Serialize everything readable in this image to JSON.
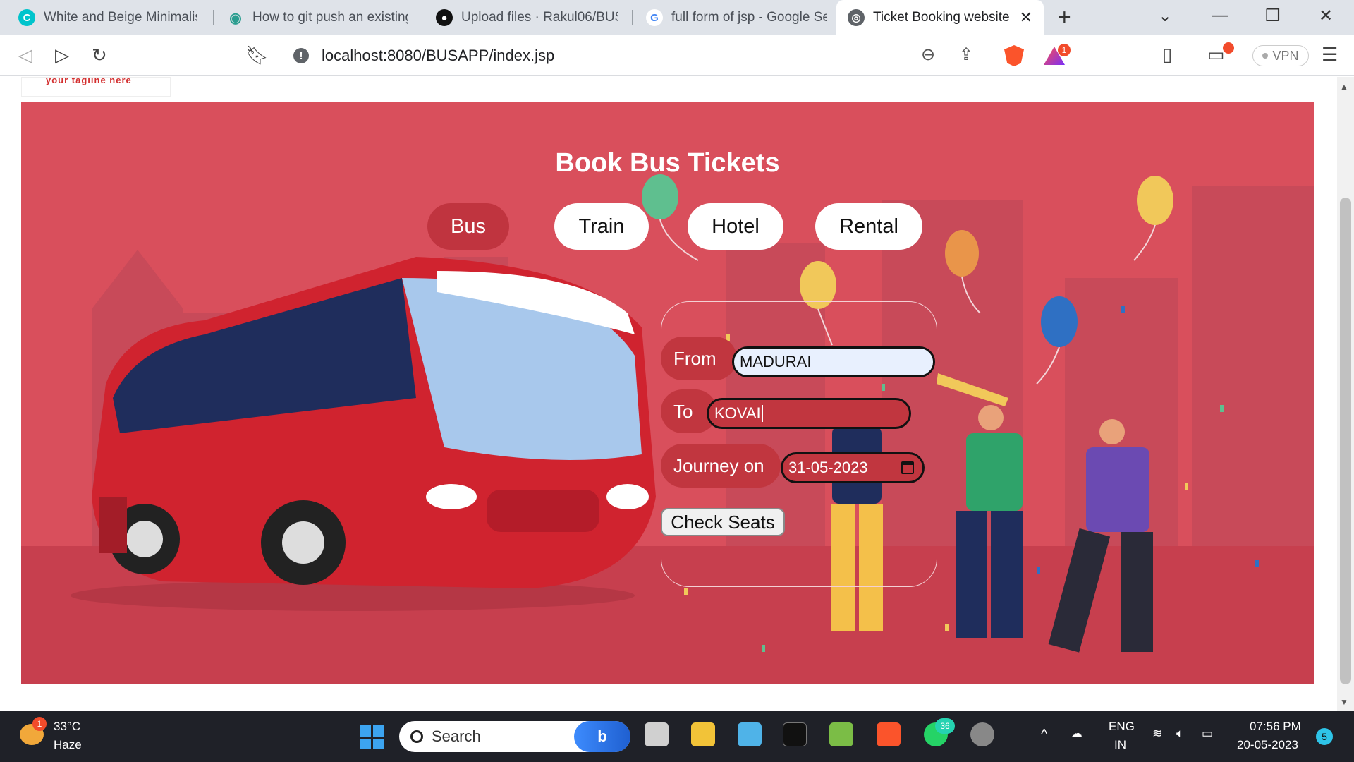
{
  "browser": {
    "tabs": [
      {
        "title": "White and Beige Minimalis",
        "icon": "canva-icon",
        "color": "#00c4cc"
      },
      {
        "title": "How to git push an existing",
        "icon": "eye-icon",
        "color": "#2a9d8f"
      },
      {
        "title": "Upload files · Rakul06/BUS",
        "icon": "github-icon",
        "color": "#111111"
      },
      {
        "title": "full form of jsp - Google Se",
        "icon": "google-icon",
        "color": "#4285f4"
      },
      {
        "title": "Ticket Booking website",
        "icon": "globe-icon",
        "color": "#5f6368"
      }
    ],
    "url": "localhost:8080/BUSAPP/index.jsp",
    "rewards_badge": "1",
    "vpn_label": "VPN"
  },
  "page": {
    "logo_tagline": "your tagline here",
    "title": "Book Bus Tickets",
    "nav": [
      {
        "label": "Bus",
        "active": true
      },
      {
        "label": "Train",
        "active": false
      },
      {
        "label": "Hotel",
        "active": false
      },
      {
        "label": "Rental",
        "active": false
      }
    ],
    "form": {
      "from_label": "From",
      "from_value": "MADURAI",
      "to_label": "To",
      "to_value": "KOVAI",
      "date_label": "Journey on",
      "date_value": "31-05-2023",
      "submit_label": "Check Seats"
    }
  },
  "taskbar": {
    "weather_temp": "33°C",
    "weather_desc": "Haze",
    "weather_badge": "1",
    "search_label": "Search",
    "whatsapp_badge": "36",
    "lang_top": "ENG",
    "lang_bottom": "IN",
    "time": "07:56 PM",
    "date": "20-05-2023",
    "notif_count": "5"
  },
  "colors": {
    "hero_bg": "#d94f5c",
    "accent_red": "#c1363f",
    "taskbar_bg": "#1f2128"
  }
}
